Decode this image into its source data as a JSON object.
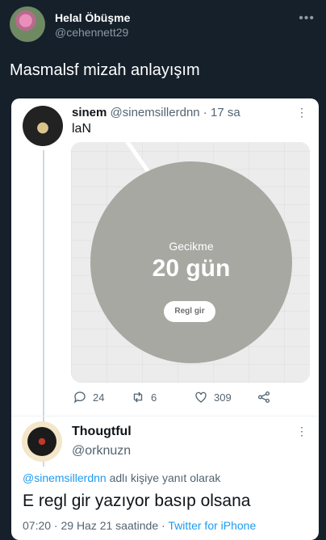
{
  "outer_tweet": {
    "display_name": "Helal Öbüşme",
    "handle": "@cehennett29",
    "more_icon": "ellipsis-icon",
    "text": "Masmalsf mizah anlayışım"
  },
  "quoted_tweet": {
    "display_name": "sinem",
    "handle": "@sinemsillerdnn",
    "separator": " · ",
    "time": "17 sa",
    "text": "laN",
    "media": {
      "label": "Gecikme",
      "value": "20 gün",
      "button_label": "Regl gir"
    },
    "actions": {
      "replies": "24",
      "retweets": "6",
      "likes": "309"
    }
  },
  "reply_tweet": {
    "display_name": "Thougtful",
    "handle": "@orknuzn",
    "replying_to": "@sinemsillerdnn",
    "replying_suffix": " adlı kişiye yanıt olarak",
    "text": "E regl gir yazıyor basıp olsana",
    "timestamp": "07:20 · 29 Haz 21 saatinde · ",
    "source": "Twitter for iPhone"
  },
  "colors": {
    "background": "#15202b",
    "card": "#ffffff",
    "link": "#1d9bf0",
    "muted": "#536471",
    "media_circle": "#a7a8a2"
  }
}
